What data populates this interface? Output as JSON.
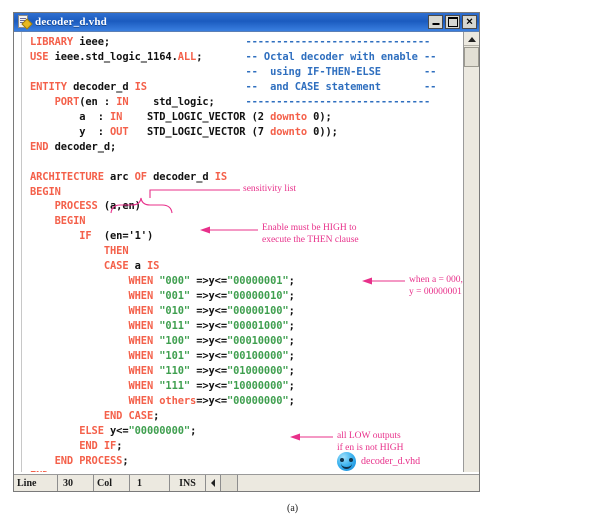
{
  "window": {
    "title": "decoder_d.vhd",
    "icon": "vhdl-file-icon",
    "buttons": {
      "minimize": "_",
      "maximize": "□",
      "close": "✕"
    }
  },
  "code": {
    "lines": [
      [
        {
          "t": "LIBRARY",
          "c": "kw"
        },
        {
          "t": " ieee;",
          "c": "pl"
        }
      ],
      [
        {
          "t": "USE",
          "c": "kw"
        },
        {
          "t": " ieee.std_logic_1164.",
          "c": "pl"
        },
        {
          "t": "ALL",
          "c": "kw"
        },
        {
          "t": ";",
          "c": "pl"
        }
      ],
      [],
      [
        {
          "t": "ENTITY",
          "c": "kw"
        },
        {
          "t": " decoder_d ",
          "c": "pl"
        },
        {
          "t": "IS",
          "c": "kw"
        }
      ],
      [
        {
          "t": "    PORT",
          "c": "kw"
        },
        {
          "t": "(en : ",
          "c": "pl"
        },
        {
          "t": "IN",
          "c": "kw"
        },
        {
          "t": "    std_logic;",
          "c": "pl"
        }
      ],
      [
        {
          "t": "        a  : ",
          "c": "pl"
        },
        {
          "t": "IN",
          "c": "kw"
        },
        {
          "t": "    STD_LOGIC_VECTOR (2 ",
          "c": "pl"
        },
        {
          "t": "downto",
          "c": "kw"
        },
        {
          "t": " 0);",
          "c": "pl"
        }
      ],
      [
        {
          "t": "        y  : ",
          "c": "pl"
        },
        {
          "t": "OUT",
          "c": "kw"
        },
        {
          "t": "   STD_LOGIC_VECTOR (7 ",
          "c": "pl"
        },
        {
          "t": "downto",
          "c": "kw"
        },
        {
          "t": " 0));",
          "c": "pl"
        }
      ],
      [
        {
          "t": "END",
          "c": "kw"
        },
        {
          "t": " decoder_d;",
          "c": "pl"
        }
      ],
      [],
      [
        {
          "t": "ARCHITECTURE",
          "c": "kw"
        },
        {
          "t": " arc ",
          "c": "pl"
        },
        {
          "t": "OF",
          "c": "kw"
        },
        {
          "t": " decoder_d ",
          "c": "pl"
        },
        {
          "t": "IS",
          "c": "kw"
        }
      ],
      [
        {
          "t": "BEGIN",
          "c": "kw"
        }
      ],
      [
        {
          "t": "    PROCESS",
          "c": "kw"
        },
        {
          "t": " (a,en)",
          "c": "pl"
        }
      ],
      [
        {
          "t": "    BEGIN",
          "c": "kw"
        }
      ],
      [
        {
          "t": "        IF",
          "c": "kw"
        },
        {
          "t": "  (en='1')",
          "c": "pl"
        }
      ],
      [
        {
          "t": "            THEN",
          "c": "kw"
        }
      ],
      [
        {
          "t": "            CASE",
          "c": "kw"
        },
        {
          "t": " a ",
          "c": "pl"
        },
        {
          "t": "IS",
          "c": "kw"
        }
      ],
      [
        {
          "t": "                WHEN",
          "c": "kw"
        },
        {
          "t": " ",
          "c": "pl"
        },
        {
          "t": "\"000\"",
          "c": "st"
        },
        {
          "t": " =>y<=",
          "c": "pl"
        },
        {
          "t": "\"00000001\"",
          "c": "st"
        },
        {
          "t": ";",
          "c": "pl"
        }
      ],
      [
        {
          "t": "                WHEN",
          "c": "kw"
        },
        {
          "t": " ",
          "c": "pl"
        },
        {
          "t": "\"001\"",
          "c": "st"
        },
        {
          "t": " =>y<=",
          "c": "pl"
        },
        {
          "t": "\"00000010\"",
          "c": "st"
        },
        {
          "t": ";",
          "c": "pl"
        }
      ],
      [
        {
          "t": "                WHEN",
          "c": "kw"
        },
        {
          "t": " ",
          "c": "pl"
        },
        {
          "t": "\"010\"",
          "c": "st"
        },
        {
          "t": " =>y<=",
          "c": "pl"
        },
        {
          "t": "\"00000100\"",
          "c": "st"
        },
        {
          "t": ";",
          "c": "pl"
        }
      ],
      [
        {
          "t": "                WHEN",
          "c": "kw"
        },
        {
          "t": " ",
          "c": "pl"
        },
        {
          "t": "\"011\"",
          "c": "st"
        },
        {
          "t": " =>y<=",
          "c": "pl"
        },
        {
          "t": "\"00001000\"",
          "c": "st"
        },
        {
          "t": ";",
          "c": "pl"
        }
      ],
      [
        {
          "t": "                WHEN",
          "c": "kw"
        },
        {
          "t": " ",
          "c": "pl"
        },
        {
          "t": "\"100\"",
          "c": "st"
        },
        {
          "t": " =>y<=",
          "c": "pl"
        },
        {
          "t": "\"00010000\"",
          "c": "st"
        },
        {
          "t": ";",
          "c": "pl"
        }
      ],
      [
        {
          "t": "                WHEN",
          "c": "kw"
        },
        {
          "t": " ",
          "c": "pl"
        },
        {
          "t": "\"101\"",
          "c": "st"
        },
        {
          "t": " =>y<=",
          "c": "pl"
        },
        {
          "t": "\"00100000\"",
          "c": "st"
        },
        {
          "t": ";",
          "c": "pl"
        }
      ],
      [
        {
          "t": "                WHEN",
          "c": "kw"
        },
        {
          "t": " ",
          "c": "pl"
        },
        {
          "t": "\"110\"",
          "c": "st"
        },
        {
          "t": " =>y<=",
          "c": "pl"
        },
        {
          "t": "\"01000000\"",
          "c": "st"
        },
        {
          "t": ";",
          "c": "pl"
        }
      ],
      [
        {
          "t": "                WHEN",
          "c": "kw"
        },
        {
          "t": " ",
          "c": "pl"
        },
        {
          "t": "\"111\"",
          "c": "st"
        },
        {
          "t": " =>y<=",
          "c": "pl"
        },
        {
          "t": "\"10000000\"",
          "c": "st"
        },
        {
          "t": ";",
          "c": "pl"
        }
      ],
      [
        {
          "t": "                WHEN others",
          "c": "kw"
        },
        {
          "t": "=>y<=",
          "c": "pl"
        },
        {
          "t": "\"00000000\"",
          "c": "st"
        },
        {
          "t": ";",
          "c": "pl"
        }
      ],
      [
        {
          "t": "            END CASE",
          "c": "kw"
        },
        {
          "t": ";",
          "c": "pl"
        }
      ],
      [
        {
          "t": "        ELSE",
          "c": "kw"
        },
        {
          "t": " y<=",
          "c": "pl"
        },
        {
          "t": "\"00000000\"",
          "c": "st"
        },
        {
          "t": ";",
          "c": "pl"
        }
      ],
      [
        {
          "t": "        END IF",
          "c": "kw"
        },
        {
          "t": ";",
          "c": "pl"
        }
      ],
      [
        {
          "t": "    END PROCESS",
          "c": "kw"
        },
        {
          "t": ";",
          "c": "pl"
        }
      ],
      [
        {
          "t": "END",
          "c": "kw"
        },
        {
          "t": " arc;",
          "c": "pl"
        }
      ]
    ],
    "comment_block": [
      "------------------------------",
      "-- Octal decoder with enable --",
      "--  using IF-THEN-ELSE       --",
      "--  and CASE statement       --",
      "------------------------------"
    ]
  },
  "annotations": [
    {
      "id": "sensitivity-list",
      "text": "sensitivity list"
    },
    {
      "id": "enable-high",
      "line1": "Enable must be HIGH to",
      "line2": "execute the THEN clause"
    },
    {
      "id": "when-a-000",
      "line1": "when a = 000,",
      "line2": "y = 00000001"
    },
    {
      "id": "all-low-outputs",
      "line1": "all LOW outputs",
      "line2": "if en is not HIGH"
    }
  ],
  "file_badge": {
    "label": "decoder_d.vhd",
    "icon": "blue-face-icon"
  },
  "statusbar": {
    "line_label": "Line",
    "line_value": "30",
    "col_label": "Col",
    "col_value": "1",
    "mode": "INS"
  },
  "caption": "(a)",
  "colors": {
    "keyword": "#f4604a",
    "comment": "#2f6fbf",
    "string": "#3f9f4f",
    "annotation": "#e8308a",
    "titlebar": "#1b5bbf"
  }
}
